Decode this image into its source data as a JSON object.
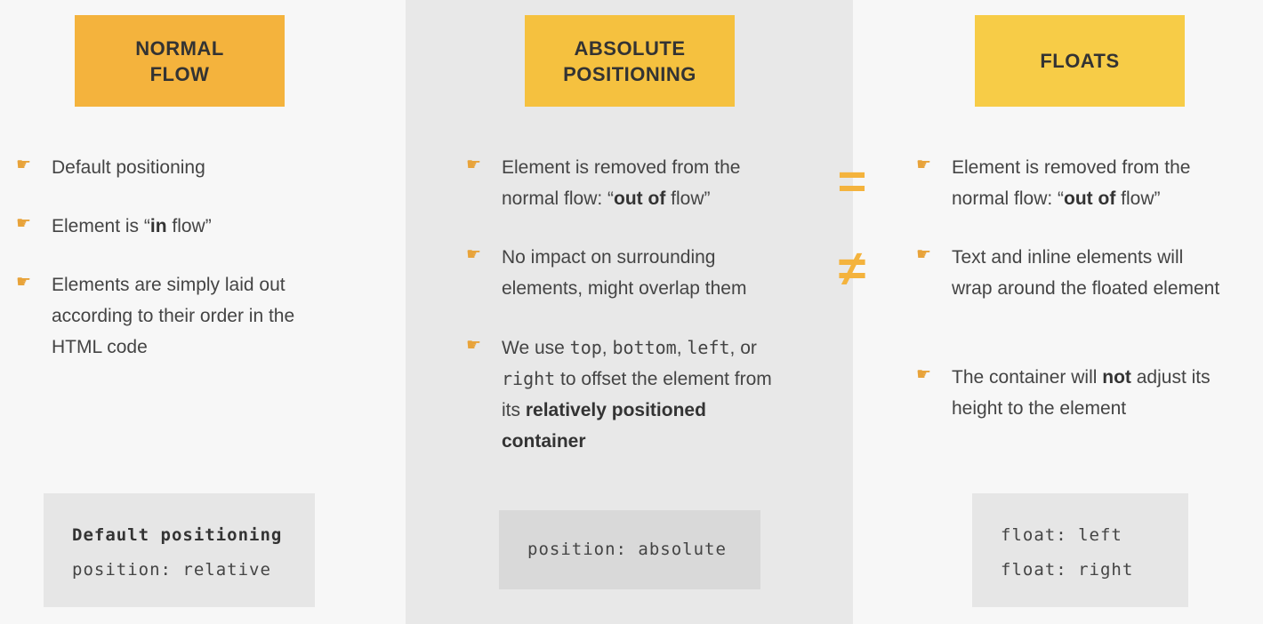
{
  "columns": [
    {
      "header": "NORMAL\nFLOW",
      "bullets": [
        {
          "text": "Default positioning"
        },
        {
          "pre": "Element is “",
          "bold": "in",
          "post": " flow”"
        },
        {
          "text": "Elements are simply laid out according to their order in the HTML code"
        }
      ],
      "code": {
        "line1": "Default positioning",
        "line2": "position: relative"
      }
    },
    {
      "header": "ABSOLUTE\nPOSITIONING",
      "bullets": [
        {
          "pre": "Element is removed from the normal flow: “",
          "bold": "out of",
          "post": " flow”"
        },
        {
          "text": "No impact on surrounding elements, might overlap them"
        },
        {
          "prefix": "We use ",
          "code1": "top",
          "sep1": ", ",
          "code2": "bottom",
          "sep2": ", ",
          "code3": "left",
          "sep3": ", or ",
          "code4": "right",
          "mid": " to offset the element from its ",
          "bold": "relatively positioned container"
        }
      ],
      "code": {
        "line1": "position: absolute"
      }
    },
    {
      "header": "FLOATS",
      "bullets": [
        {
          "pre": "Element is removed from the normal flow: “",
          "bold": "out of",
          "post": " flow”"
        },
        {
          "text": "Text and inline elements will wrap around the floated element"
        },
        {
          "pre": "The container will ",
          "bold": "not",
          "post": " adjust its height to the element"
        }
      ],
      "code": {
        "line1": "float: left",
        "line2": "float: right"
      }
    }
  ],
  "symbols": {
    "equal": "=",
    "not_equal": "≠"
  },
  "icons": {
    "bullet": "pointing-hand-icon",
    "bullet_glyph": "☛"
  },
  "colors": {
    "header1": "#f4b33d",
    "header2": "#f5c13f",
    "header3": "#f7cc47",
    "accent": "#f4b33d"
  }
}
